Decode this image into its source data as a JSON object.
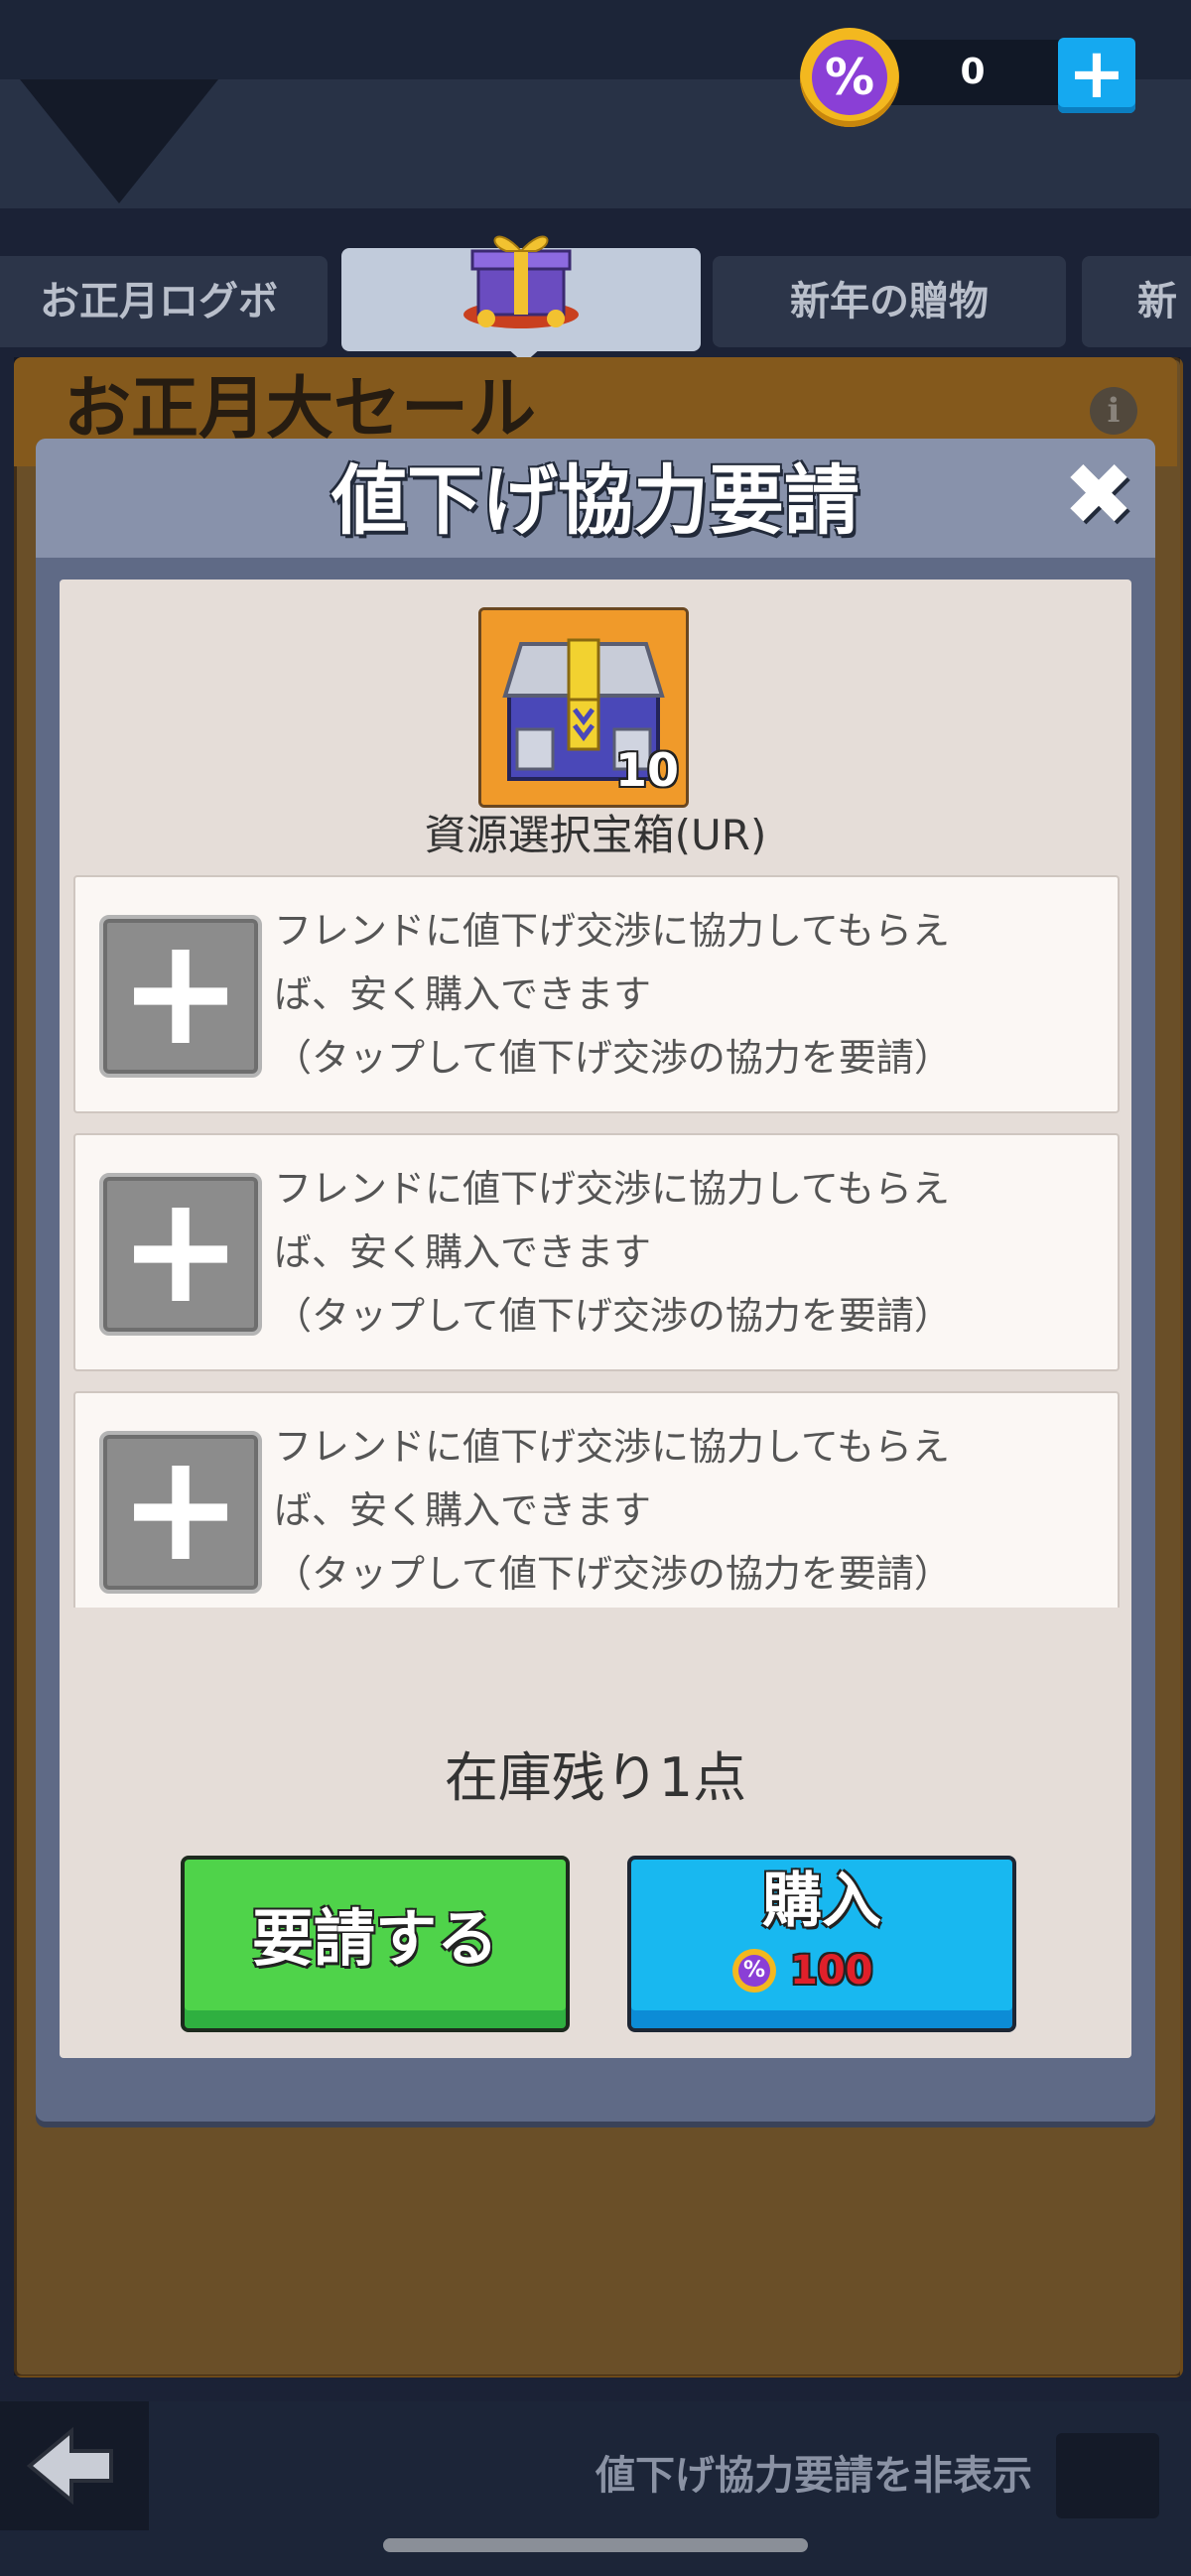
{
  "currency": {
    "icon": "discount-coin-icon",
    "value": "0",
    "add_symbol": "+"
  },
  "tabs": [
    {
      "label": "お正月ログボ",
      "active": false
    },
    {
      "label": "",
      "active": true
    },
    {
      "label": "新年の贈物",
      "active": false
    },
    {
      "label": "新",
      "active": false
    }
  ],
  "background_panel": {
    "title": "お正月大セール",
    "info_symbol": "i"
  },
  "modal": {
    "title": "値下げ協力要請",
    "close_symbol": "✖",
    "item": {
      "name": "資源選択宝箱(UR)",
      "count": "10"
    },
    "slots": [
      {
        "line1": "フレンドに値下げ交渉に協力してもらえ",
        "line2": "ば、安く購入できます",
        "line3": "（タップして値下げ交渉の協力を要請）"
      },
      {
        "line1": "フレンドに値下げ交渉に協力してもらえ",
        "line2": "ば、安く購入できます",
        "line3": "（タップして値下げ交渉の協力を要請）"
      },
      {
        "line1": "フレンドに値下げ交渉に協力してもらえ",
        "line2": "ば、安く購入できます",
        "line3": "（タップして値下げ交渉の協力を要請）"
      }
    ],
    "slot_plus_symbol": "+",
    "stock": "在庫残り1点",
    "request_button": "要請する",
    "buy_button": {
      "label": "購入",
      "price": "100"
    }
  },
  "bottom": {
    "hide_label": "値下げ協力要請を非表示",
    "back_symbol": "🡄"
  },
  "colors": {
    "request_green": "#4fd34a",
    "buy_blue": "#18b8f0",
    "price_red": "#e0202a",
    "coin_purple": "#8a3fd6"
  }
}
